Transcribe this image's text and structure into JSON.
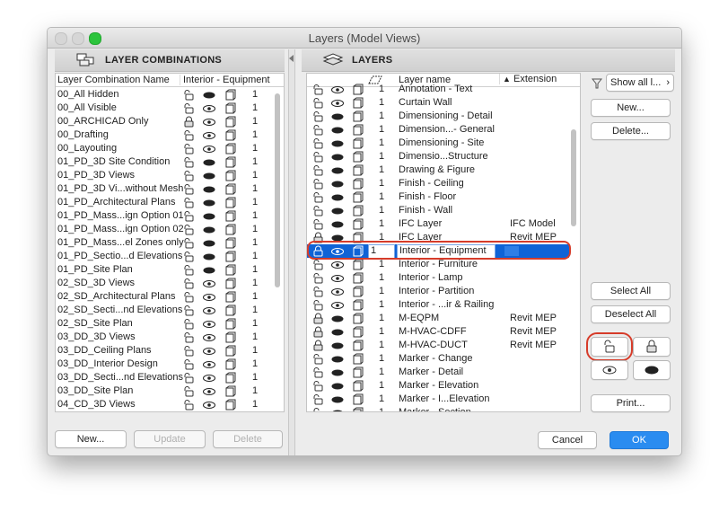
{
  "window": {
    "title": "Layers (Model Views)"
  },
  "left_panel": {
    "title": "LAYER COMBINATIONS",
    "col_name": "Layer Combination Name",
    "col_combo": "Interior - Equipment",
    "rows": [
      {
        "name": "00_All Hidden",
        "lock": "open",
        "vis": "solid",
        "num": "1"
      },
      {
        "name": "00_All Visible",
        "lock": "open",
        "vis": "eye",
        "num": "1"
      },
      {
        "name": "00_ARCHICAD Only",
        "lock": "closed",
        "vis": "eye",
        "num": "1"
      },
      {
        "name": "00_Drafting",
        "lock": "open",
        "vis": "eye",
        "num": "1"
      },
      {
        "name": "00_Layouting",
        "lock": "open",
        "vis": "eye",
        "num": "1"
      },
      {
        "name": "01_PD_3D Site Condition",
        "lock": "open",
        "vis": "solid",
        "num": "1"
      },
      {
        "name": "01_PD_3D Views",
        "lock": "open",
        "vis": "solid",
        "num": "1"
      },
      {
        "name": "01_PD_3D Vi...without Mesh",
        "lock": "open",
        "vis": "solid",
        "num": "1"
      },
      {
        "name": "01_PD_Architectural Plans",
        "lock": "open",
        "vis": "solid",
        "num": "1"
      },
      {
        "name": "01_PD_Mass...ign Option 01",
        "lock": "open",
        "vis": "solid",
        "num": "1"
      },
      {
        "name": "01_PD_Mass...ign Option 02",
        "lock": "open",
        "vis": "solid",
        "num": "1"
      },
      {
        "name": "01_PD_Mass...el Zones only",
        "lock": "open",
        "vis": "solid",
        "num": "1"
      },
      {
        "name": "01_PD_Sectio...d Elevations",
        "lock": "open",
        "vis": "solid",
        "num": "1"
      },
      {
        "name": "01_PD_Site Plan",
        "lock": "open",
        "vis": "solid",
        "num": "1"
      },
      {
        "name": "02_SD_3D Views",
        "lock": "open",
        "vis": "eye",
        "num": "1"
      },
      {
        "name": "02_SD_Architectural Plans",
        "lock": "open",
        "vis": "eye",
        "num": "1"
      },
      {
        "name": "02_SD_Secti...nd Elevations",
        "lock": "open",
        "vis": "eye",
        "num": "1"
      },
      {
        "name": "02_SD_Site Plan",
        "lock": "open",
        "vis": "eye",
        "num": "1"
      },
      {
        "name": "03_DD_3D Views",
        "lock": "open",
        "vis": "eye",
        "num": "1"
      },
      {
        "name": "03_DD_Ceiling Plans",
        "lock": "open",
        "vis": "eye",
        "num": "1"
      },
      {
        "name": "03_DD_Interior Design",
        "lock": "open",
        "vis": "eye",
        "num": "1"
      },
      {
        "name": "03_DD_Secti...nd Elevations",
        "lock": "open",
        "vis": "eye",
        "num": "1"
      },
      {
        "name": "03_DD_Site Plan",
        "lock": "open",
        "vis": "eye",
        "num": "1"
      },
      {
        "name": "04_CD_3D Views",
        "lock": "open",
        "vis": "eye",
        "num": "1"
      }
    ],
    "new_button": "New...",
    "update_button": "Update",
    "delete_button": "Delete"
  },
  "right_panel": {
    "title": "LAYERS",
    "col_name": "Layer name",
    "col_ext": "Extension",
    "sort_arrow": "▲",
    "rows": [
      {
        "name": "Annotation - Text",
        "ext": "",
        "lock": "open",
        "vis": "eye",
        "num": "1",
        "partial": true
      },
      {
        "name": "Curtain Wall",
        "ext": "",
        "lock": "open",
        "vis": "eye",
        "num": "1"
      },
      {
        "name": "Dimensioning - Detail",
        "ext": "",
        "lock": "open",
        "vis": "solid",
        "num": "1"
      },
      {
        "name": "Dimension...- General",
        "ext": "",
        "lock": "open",
        "vis": "solid",
        "num": "1"
      },
      {
        "name": "Dimensioning - Site",
        "ext": "",
        "lock": "open",
        "vis": "solid",
        "num": "1"
      },
      {
        "name": "Dimensio...Structure",
        "ext": "",
        "lock": "open",
        "vis": "solid",
        "num": "1"
      },
      {
        "name": "Drawing & Figure",
        "ext": "",
        "lock": "open",
        "vis": "solid",
        "num": "1"
      },
      {
        "name": "Finish - Ceiling",
        "ext": "",
        "lock": "open",
        "vis": "solid",
        "num": "1"
      },
      {
        "name": "Finish - Floor",
        "ext": "",
        "lock": "open",
        "vis": "solid",
        "num": "1"
      },
      {
        "name": "Finish - Wall",
        "ext": "",
        "lock": "open",
        "vis": "solid",
        "num": "1"
      },
      {
        "name": "IFC Layer",
        "ext": "IFC Model",
        "lock": "open",
        "vis": "solid",
        "num": "1"
      },
      {
        "name": "IFC Layer",
        "ext": "Revit MEP",
        "lock": "closed",
        "vis": "solid",
        "num": "1"
      },
      {
        "name": "Interior - Equipment",
        "ext": "",
        "lock": "closed",
        "vis": "eye",
        "num": "1",
        "selected": true
      },
      {
        "name": "Interior - Furniture",
        "ext": "",
        "lock": "open",
        "vis": "eye",
        "num": "1"
      },
      {
        "name": "Interior - Lamp",
        "ext": "",
        "lock": "open",
        "vis": "eye",
        "num": "1"
      },
      {
        "name": "Interior - Partition",
        "ext": "",
        "lock": "open",
        "vis": "eye",
        "num": "1"
      },
      {
        "name": "Interior - ...ir & Railing",
        "ext": "",
        "lock": "open",
        "vis": "eye",
        "num": "1"
      },
      {
        "name": "M-EQPM",
        "ext": "Revit MEP",
        "lock": "closed",
        "vis": "solid",
        "num": "1"
      },
      {
        "name": "M-HVAC-CDFF",
        "ext": "Revit MEP",
        "lock": "closed",
        "vis": "solid",
        "num": "1"
      },
      {
        "name": "M-HVAC-DUCT",
        "ext": "Revit MEP",
        "lock": "closed",
        "vis": "solid",
        "num": "1"
      },
      {
        "name": "Marker - Change",
        "ext": "",
        "lock": "open",
        "vis": "solid",
        "num": "1"
      },
      {
        "name": "Marker - Detail",
        "ext": "",
        "lock": "open",
        "vis": "solid",
        "num": "1"
      },
      {
        "name": "Marker - Elevation",
        "ext": "",
        "lock": "open",
        "vis": "solid",
        "num": "1"
      },
      {
        "name": "Marker - I...Elevation",
        "ext": "",
        "lock": "open",
        "vis": "solid",
        "num": "1"
      },
      {
        "name": "Marker - Section",
        "ext": "",
        "lock": "open",
        "vis": "solid",
        "num": "1",
        "partial": true
      }
    ]
  },
  "side_buttons": {
    "filter": "Show all l...",
    "new": "New...",
    "delete": "Delete...",
    "select_all": "Select All",
    "deselect_all": "Deselect All",
    "print": "Print..."
  },
  "footer": {
    "cancel": "Cancel",
    "ok": "OK"
  },
  "colors": {
    "accent": "#0f63d6",
    "highlight_ring": "#d63c2a",
    "ok_button": "#2a8cf0"
  }
}
